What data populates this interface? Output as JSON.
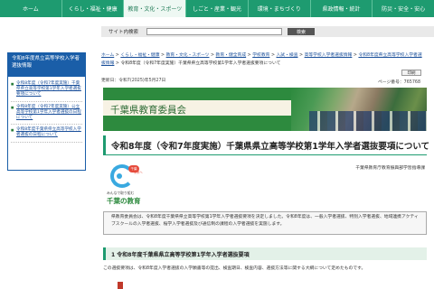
{
  "nav": {
    "items": [
      {
        "label": "ホーム"
      },
      {
        "label": "くらし・福祉・健康"
      },
      {
        "label": "教育・文化・スポーツ"
      },
      {
        "label": "しごと・産業・観光"
      },
      {
        "label": "環境・まちづくり"
      },
      {
        "label": "県政情報・統計"
      },
      {
        "label": "防災・安全・安心"
      }
    ]
  },
  "search": {
    "label": "サイト内検索",
    "button": "検索"
  },
  "sidebar": {
    "heading": "令和8年度県立高等学校入学者選抜情報",
    "items": [
      {
        "label": "令和8年度（令和7年度実施）千葉県県立高等学校第1学年入学者選抜要項について"
      },
      {
        "label": "令和8年度（令和7年度実施）公立高等学校第1学年入学者選抜の日程について"
      },
      {
        "label": "令和8年度千葉県県立高等学校入学者選抜の日程について"
      }
    ]
  },
  "breadcrumb": {
    "items": [
      "ホーム",
      "くらし・福祉・健康",
      "教育・文化・スポーツ",
      "教育・健全育成",
      "学校教育",
      "入試・検査",
      "高等学校入学者選抜情報",
      "令和8年度県立高等学校入学者選抜情報"
    ],
    "current": "令和8年度（令和7年度実施）千葉県県立高等学校第1学年入学者選抜要項について"
  },
  "meta": {
    "updated": "更新日：令和7(2025)年5月27日",
    "page_id": "ページ番号：765768",
    "print": "印刷"
  },
  "banner": {
    "title": "千葉県教育委員会"
  },
  "page": {
    "title": "令和8年度（令和7年度実施）千葉県県立高等学校第1学年入学者選抜要項について",
    "department": "千葉県教育庁教育振興部学習指導課"
  },
  "logo": {
    "badge": "千葉",
    "tag": "未来へ",
    "caption": "みんなで取り組む",
    "brand": "千葉の教育"
  },
  "notice": {
    "text": "県教育委員会は、令和8年度千葉県県立高等学校第1学年入学者選抜要項を決定しました。令和8年度は、一般入学者選抜、特別入学者選抜、地域連携アクティブスクールの入学者選抜、桜学入学者選抜及び通信制の課程の入学者選抜を実施します。"
  },
  "section": {
    "heading": "1  令和8年度千葉県県立高等学校第1学年入学者選抜要項"
  },
  "body": {
    "text": "この選抜要項は、令和8年度入学者選抜の入学願書等の提出、検査期日、検査内容、選抜方法等に関する大綱について定めたものです。"
  }
}
